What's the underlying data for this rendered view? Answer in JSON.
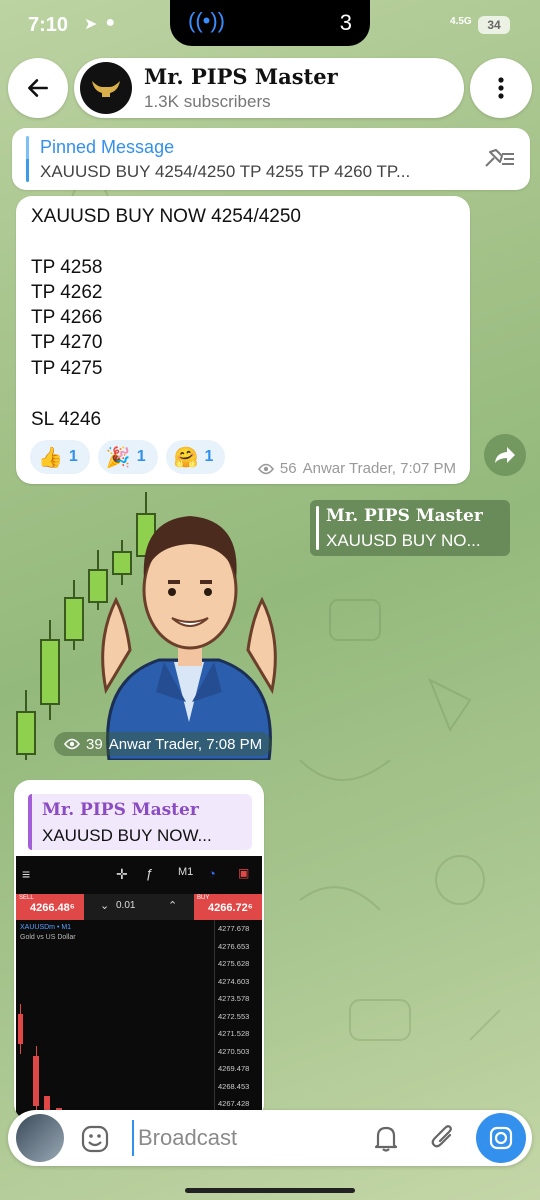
{
  "status_bar": {
    "time": "7:10",
    "notch_count": "3",
    "network": "4.5G",
    "battery": "34"
  },
  "header": {
    "channel_name": "Mr. PIPS Master",
    "subscribers": "1.3K subscribers"
  },
  "pinned": {
    "label": "Pinned Message",
    "text": "XAUUSD BUY 4254/4250  TP 4255 TP 4260 TP..."
  },
  "message1": {
    "lines": [
      "XAUUSD BUY NOW 4254/4250",
      "",
      "TP 4258",
      "TP 4262",
      "TP 4266",
      "TP 4270",
      "TP 4275",
      "",
      "SL 4246"
    ],
    "reactions": [
      {
        "emoji": "👍",
        "count": "1"
      },
      {
        "emoji": "🎉",
        "count": "1"
      },
      {
        "emoji": "🤗",
        "count": "1"
      }
    ],
    "views": "56",
    "author_time": "Anwar Trader, 7:07 PM"
  },
  "reply_bubble": {
    "name": "Mr. PIPS Master",
    "text": "XAUUSD BUY NO..."
  },
  "sticker_message": {
    "views": "39",
    "author_time": "Anwar Trader, 7:08 PM"
  },
  "message3": {
    "quote_name": "Mr. PIPS Master",
    "quote_text": "XAUUSD BUY NOW...",
    "trade_screen": {
      "timeframe": "M1",
      "sell_label": "SELL",
      "sell_price": "4266.48⁶",
      "buy_label": "BUY",
      "buy_price": "4266.72⁶",
      "lot": "0.01",
      "symbol": "XAUUSDm • M1",
      "description": "Gold vs US Dollar",
      "price_axis": [
        "4277.678",
        "4276.653",
        "4275.628",
        "4274.603",
        "4273.578",
        "4272.553",
        "4271.528",
        "4270.503",
        "4269.478",
        "4268.453",
        "4267.428"
      ]
    }
  },
  "composer": {
    "placeholder": "Broadcast"
  },
  "colors": {
    "accent": "#3390ec",
    "sell_red": "#e04848",
    "quote_purple": "#a25ed6"
  }
}
